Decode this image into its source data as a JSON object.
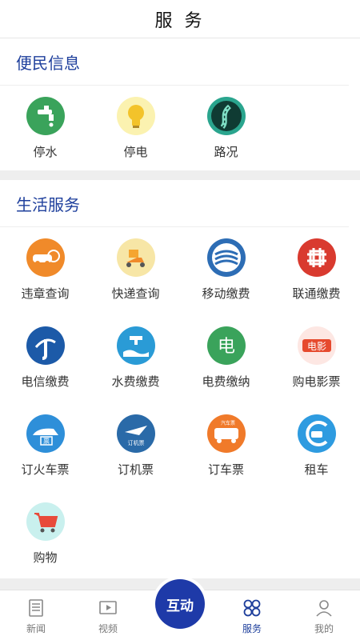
{
  "header": {
    "title": "服 务"
  },
  "sections": [
    {
      "title": "便民信息",
      "items": [
        {
          "label": "停水",
          "icon": "water-tap-icon",
          "color": "#3aa35b"
        },
        {
          "label": "停电",
          "icon": "lightbulb-icon",
          "color": "#f3d33a"
        },
        {
          "label": "路况",
          "icon": "road-icon",
          "color": "#2aa58e"
        }
      ]
    },
    {
      "title": "生活服务",
      "items": [
        {
          "label": "违章查询",
          "icon": "car-violation-icon",
          "color": "#f08a2a"
        },
        {
          "label": "快递查询",
          "icon": "scooter-delivery-icon",
          "color": "#f5a530"
        },
        {
          "label": "移动缴费",
          "icon": "china-mobile-icon",
          "color": "#2d6db5"
        },
        {
          "label": "联通缴费",
          "icon": "china-unicom-icon",
          "color": "#d93a2f"
        },
        {
          "label": "电信缴费",
          "icon": "china-telecom-icon",
          "color": "#1c5aa8"
        },
        {
          "label": "水费缴费",
          "icon": "water-bill-icon",
          "color": "#2a9bd6"
        },
        {
          "label": "电费缴纳",
          "icon": "electricity-bill-icon",
          "color": "#3aa35b"
        },
        {
          "label": "购电影票",
          "icon": "movie-ticket-icon",
          "color": "#e64a2e",
          "icon_text": "电影"
        },
        {
          "label": "订火车票",
          "icon": "train-ticket-icon",
          "color": "#2e8fd9",
          "icon_text": "票"
        },
        {
          "label": "订机票",
          "icon": "plane-ticket-icon",
          "color": "#2a6aa8",
          "icon_text": "订机票"
        },
        {
          "label": "订车票",
          "icon": "bus-ticket-icon",
          "color": "#f07a2a",
          "icon_text": "汽车票"
        },
        {
          "label": "租车",
          "icon": "car-rental-icon",
          "color": "#2e9be0"
        },
        {
          "label": "购物",
          "icon": "shopping-cart-icon",
          "color": "#e84a3a"
        }
      ]
    }
  ],
  "tabbar": {
    "tabs": [
      {
        "label": "新闻",
        "icon": "news-icon"
      },
      {
        "label": "视频",
        "icon": "video-icon"
      },
      {
        "label": "服务",
        "icon": "services-grid-icon",
        "active": true
      },
      {
        "label": "我的",
        "icon": "profile-icon"
      }
    ],
    "center": {
      "label": "互动",
      "color": "#1e3aa8"
    }
  },
  "colors": {
    "accent": "#1e3f9c",
    "divider": "#eeeeee"
  }
}
